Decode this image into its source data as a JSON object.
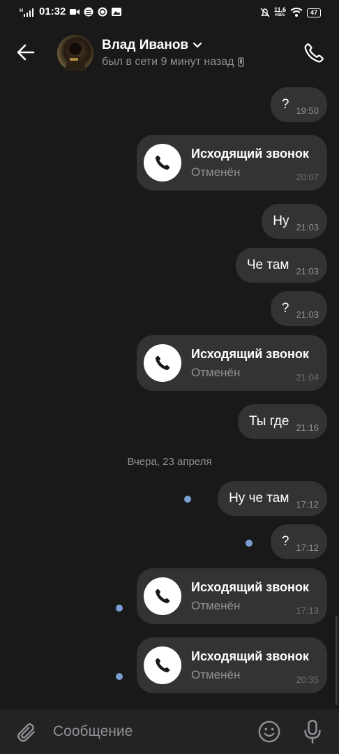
{
  "status_bar": {
    "time": "01:32",
    "net_speed": "11,6",
    "net_unit": "KB/s",
    "battery": "47"
  },
  "header": {
    "name": "Влад Иванов",
    "status": "был в сети 9 минут назад"
  },
  "messages": [
    {
      "text": "?",
      "time": "19:50"
    },
    {
      "call_title": "Исходящий звонок",
      "call_status": "Отменён",
      "time": "20:07"
    },
    {
      "text": "Ну",
      "time": "21:03"
    },
    {
      "text": "Че там",
      "time": "21:03"
    },
    {
      "text": "?",
      "time": "21:03"
    },
    {
      "call_title": "Исходящий звонок",
      "call_status": "Отменён",
      "time": "21:04"
    },
    {
      "text": "Ты где",
      "time": "21:16"
    },
    {
      "text": "Ну че там",
      "time": "17:12"
    },
    {
      "text": "?",
      "time": "17:12"
    },
    {
      "call_title": "Исходящий звонок",
      "call_status": "Отменён",
      "time": "17:13"
    },
    {
      "call_title": "Исходящий звонок",
      "call_status": "Отменён",
      "time": "20:35"
    }
  ],
  "date_separator": "Вчера, 23 апреля",
  "composer": {
    "placeholder": "Сообщение"
  },
  "colors": {
    "background": "#191919",
    "bubble": "#333333",
    "unread_dot": "#7a9fd0",
    "muted": "#8e9196"
  },
  "icons": [
    "back-arrow-icon",
    "chevron-down-icon",
    "mobile-icon",
    "phone-icon",
    "paperclip-icon",
    "emoji-icon",
    "microphone-icon"
  ]
}
